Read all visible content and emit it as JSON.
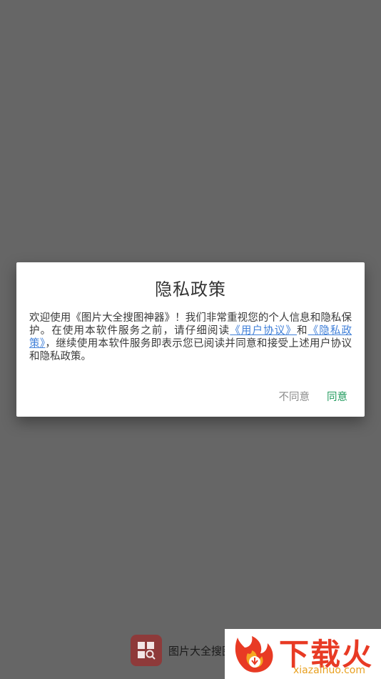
{
  "dialog": {
    "title": "隐私政策",
    "body_prefix": "欢迎使用《图片大全搜图神器》！我们非常重视您的个人信息和隐私保护。在使用本软件服务之前，请仔细阅读",
    "link_user_agreement": "《用户协议》",
    "body_and": "和",
    "link_privacy_policy": "《隐私政策》",
    "body_suffix": "，继续使用本软件服务即表示您已阅读并同意和接受上述用户协议和隐私政策。",
    "disagree_label": "不同意",
    "agree_label": "同意"
  },
  "footer": {
    "app_name": "图片大全搜图"
  },
  "watermark": {
    "title": "下载火",
    "site": "xiazaihuo.com"
  },
  "colors": {
    "overlay": "#666666",
    "link": "#3f7fd8",
    "agree": "#1f9a5c",
    "disagree": "#8c8c8c",
    "app_icon": "#8e3a3a",
    "watermark": "#e83a24"
  }
}
